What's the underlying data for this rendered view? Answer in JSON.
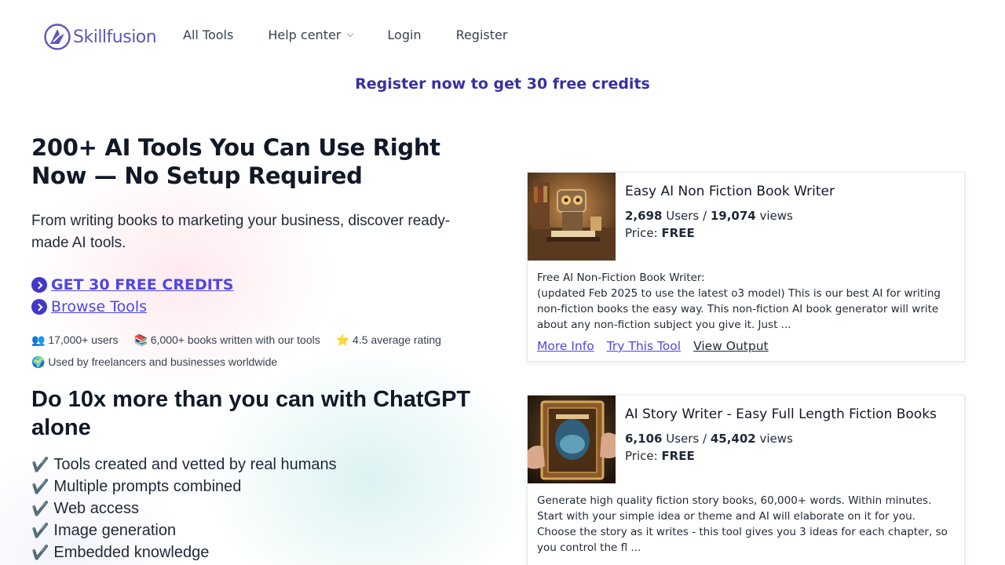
{
  "brand": {
    "name": "Skillfusion",
    "color": "#5b58b8",
    "logo_icon": "skillfusion-logo-icon"
  },
  "nav": {
    "all_tools": "All Tools",
    "help_center": "Help center",
    "login": "Login",
    "register": "Register"
  },
  "banner": "Register now to get 30 free credits",
  "hero": {
    "title": "200+ AI Tools You Can Use Right Now — No Setup Required",
    "subtitle": "From writing books to marketing your business, discover ready-made AI tools.",
    "cta_primary": "GET 30 FREE CREDITS",
    "cta_secondary": "Browse Tools"
  },
  "stats": {
    "users": "👥 17,000+ users",
    "books": "📚 6,000+ books written with our tools",
    "rating": "⭐ 4.5 average rating",
    "worldwide": "🌍 Used by freelancers and businesses worldwide"
  },
  "section": {
    "heading": "Do 10x more than you can with ChatGPT alone",
    "features": [
      "Tools created and vetted by real humans",
      "Multiple prompts combined",
      "Web access",
      "Image generation",
      "Embedded knowledge"
    ]
  },
  "tools": [
    {
      "title": "Easy AI Non Fiction Book Writer",
      "users": "2,698",
      "users_label": "Users /",
      "views": "19,074",
      "views_label": "views",
      "price_label": "Price:",
      "price": "FREE",
      "desc_line1": "Free AI Non-Fiction Book Writer:",
      "desc_line2": "(updated Feb 2025 to use the latest o3 model) This is our best AI for writing non-fiction books the easy way. This non-fiction AI book generator will write about any non-fiction subject you give it. Just ...",
      "more_info": "More Info",
      "try_tool": "Try This Tool",
      "view_output": "View Output",
      "thumb_icon": "robot-writer-thumbnail"
    },
    {
      "title": "AI Story Writer - Easy Full Length Fiction Books",
      "users": "6,106",
      "users_label": "Users /",
      "views": "45,402",
      "views_label": "views",
      "price_label": "Price:",
      "price": "FREE",
      "desc_line1": "Generate high quality fiction story books, 60,000+ words. Within minutes. Start with your simple idea or theme and AI will elaborate on it for you. Choose the story as it writes - this tool gives you 3 ideas for each chapter, so you control the fl ...",
      "thumb_icon": "storybook-thumbnail"
    }
  ],
  "colors": {
    "accent": "#4f46e5",
    "banner": "#3730a3",
    "cta_icon": "#4338ca"
  }
}
